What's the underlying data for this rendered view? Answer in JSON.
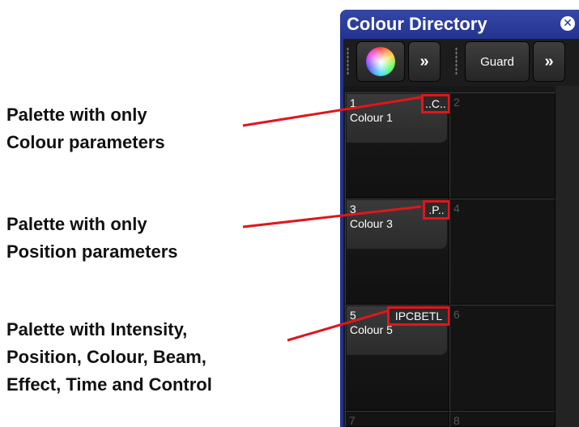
{
  "annotations": [
    {
      "lines": [
        "Palette with only",
        "Colour parameters"
      ]
    },
    {
      "lines": [
        "Palette with only",
        "Position parameters"
      ]
    },
    {
      "lines": [
        "Palette with Intensity,",
        "Position, Colour, Beam,",
        "Effect, Time and Control"
      ]
    }
  ],
  "window": {
    "title": "Colour Directory",
    "close_icon": "close-icon",
    "toolbar": {
      "color_picker_icon": "colour-wheel-icon",
      "more_label": "»",
      "guard_label": "Guard",
      "more2_label": "»"
    }
  },
  "palettes": [
    {
      "number": "1",
      "name": "Colour 1",
      "params": "..C.."
    },
    {
      "number": "2",
      "name": "",
      "params": ""
    },
    {
      "number": "3",
      "name": "Colour 3",
      "params": ".P.."
    },
    {
      "number": "4",
      "name": "",
      "params": ""
    },
    {
      "number": "5",
      "name": "Colour 5",
      "params": "IPCBETL"
    },
    {
      "number": "6",
      "name": "",
      "params": ""
    },
    {
      "number": "7",
      "name": "",
      "params": ""
    },
    {
      "number": "8",
      "name": "",
      "params": ""
    }
  ],
  "colors": {
    "window_blue": "#23338f",
    "highlight_red": "#e0161c"
  }
}
